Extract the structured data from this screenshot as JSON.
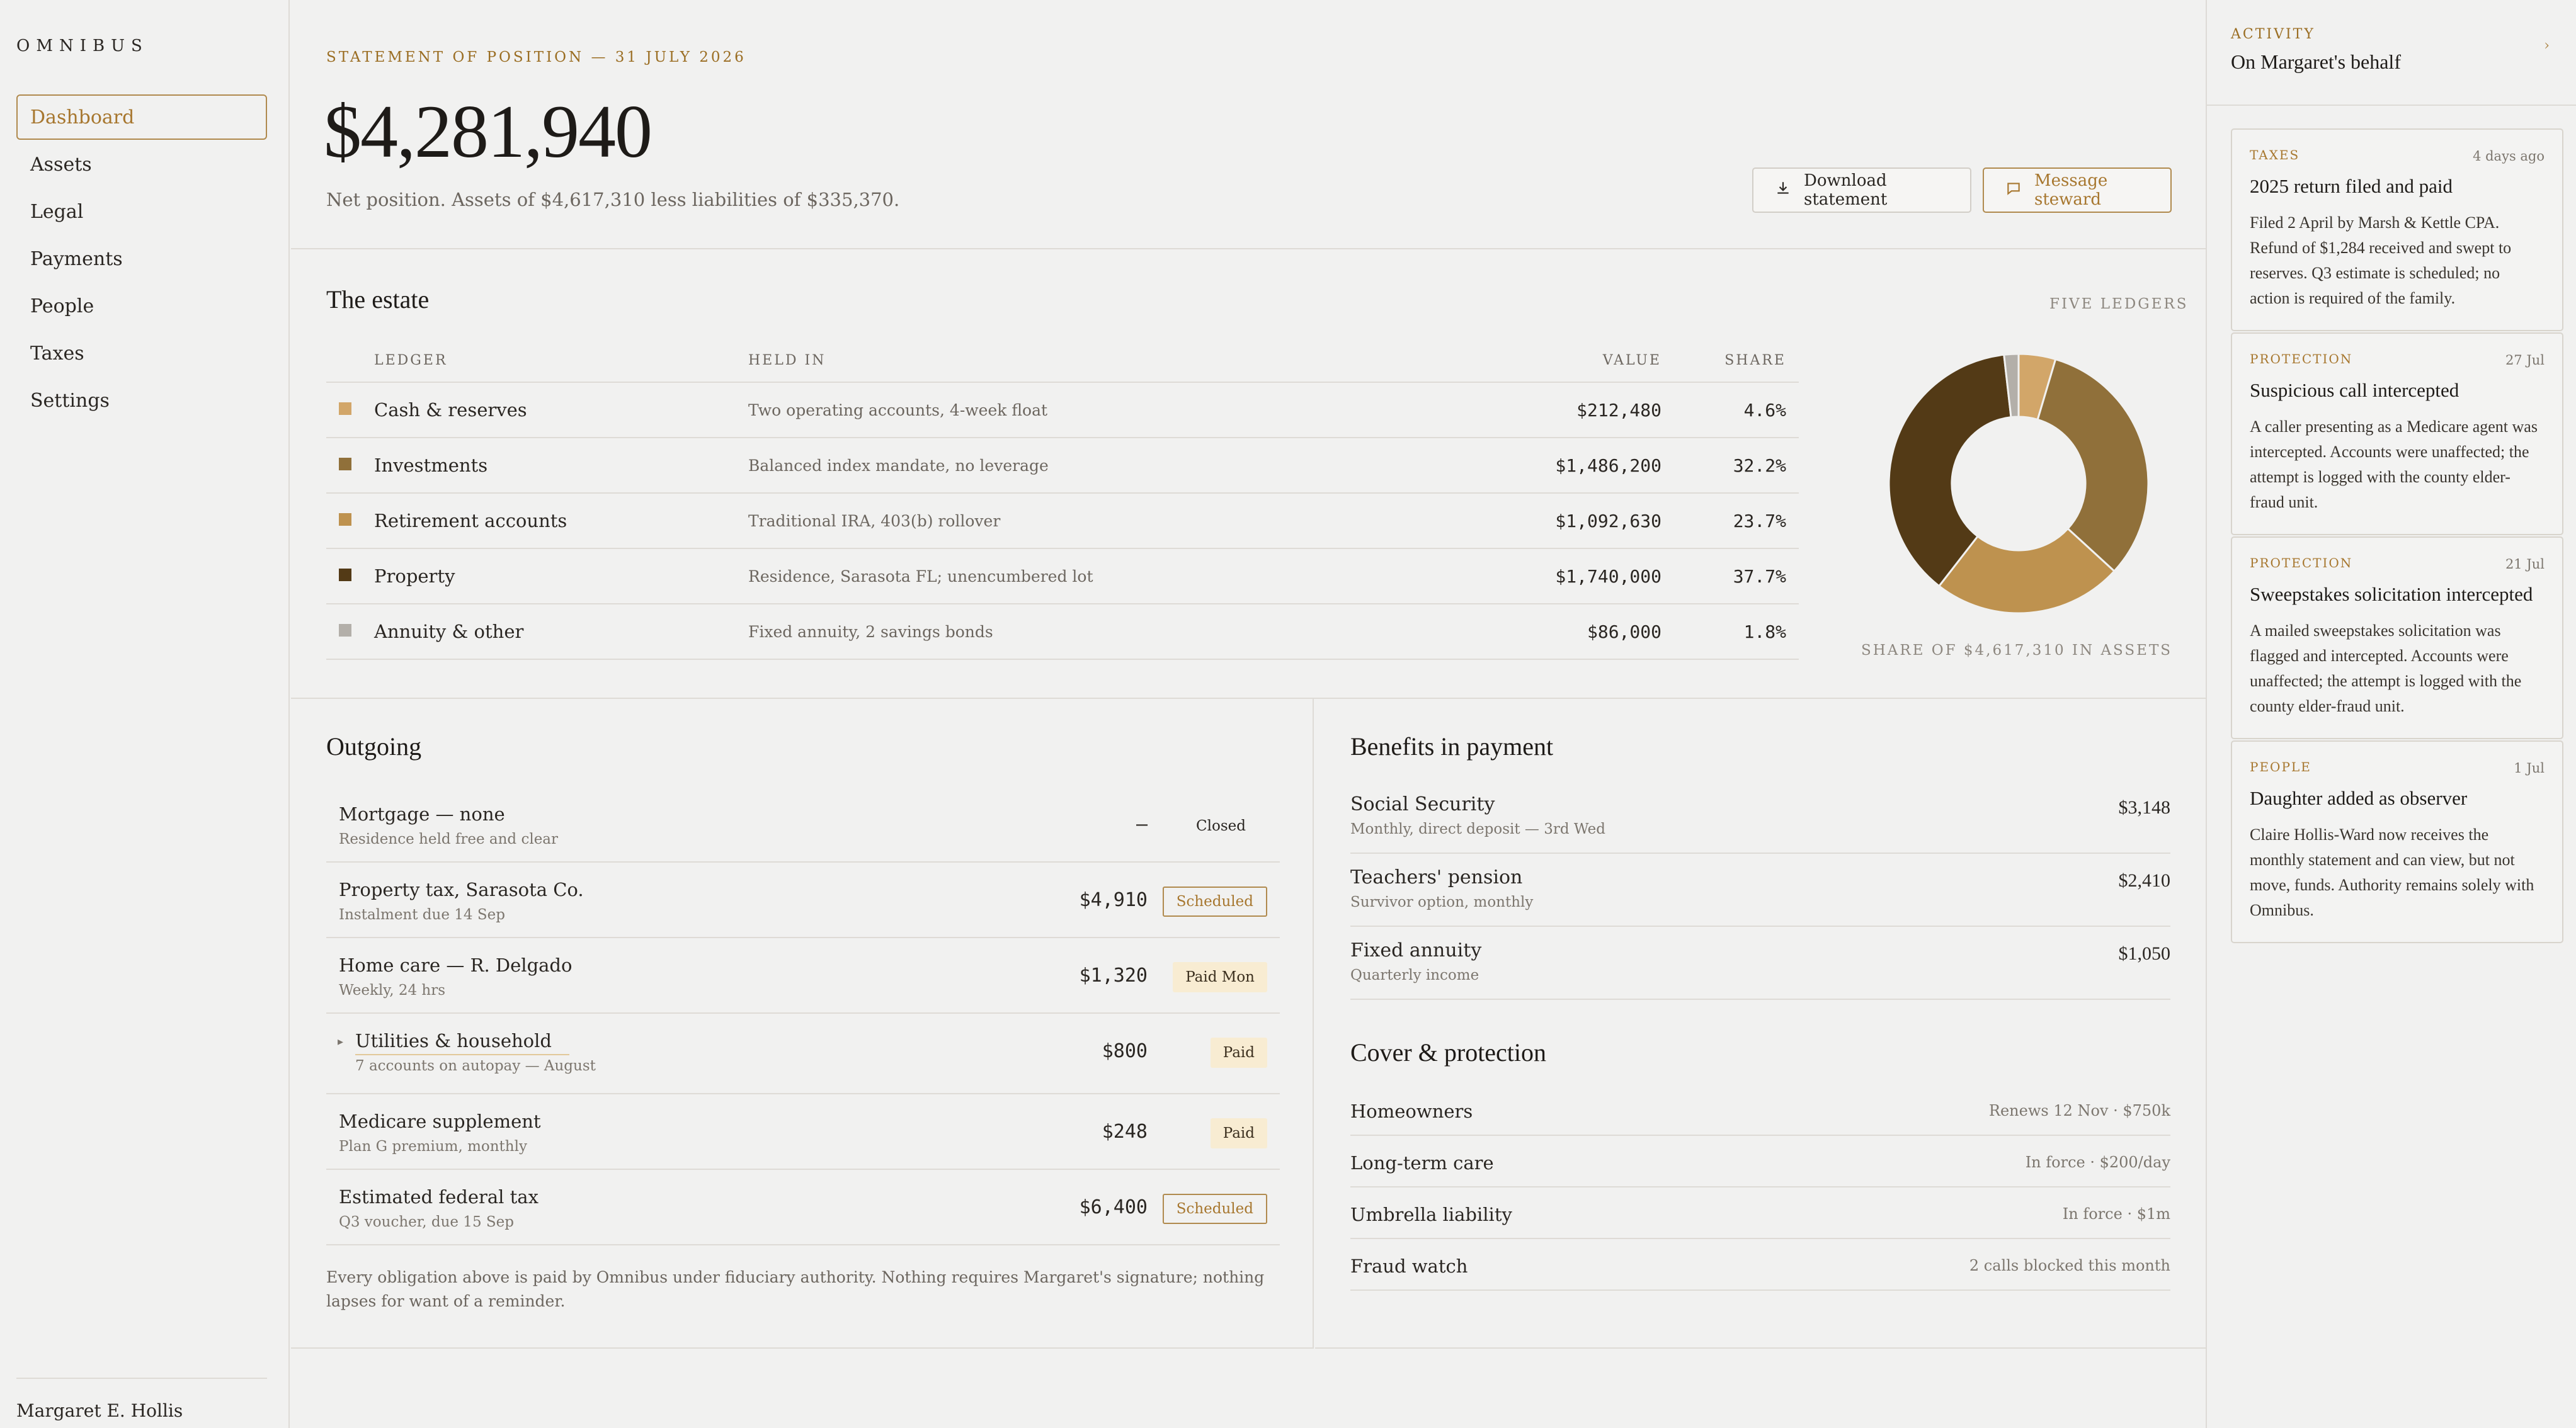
{
  "app": {
    "brand": "OMNIBUS"
  },
  "nav": {
    "items": [
      {
        "label": "Dashboard"
      },
      {
        "label": "Assets"
      },
      {
        "label": "Legal"
      },
      {
        "label": "Payments"
      },
      {
        "label": "People"
      },
      {
        "label": "Taxes"
      },
      {
        "label": "Settings"
      }
    ],
    "active": "Dashboard",
    "user": "Margaret E. Hollis"
  },
  "hero": {
    "eyebrow": "STATEMENT OF POSITION — 31 JULY 2026",
    "amount": "$4,281,940",
    "subtitle": "Net position. Assets of $4,617,310 less liabilities of $335,370.",
    "download_label": "Download statement",
    "message_label": "Message steward"
  },
  "estate": {
    "title": "The estate",
    "tag": "FIVE LEDGERS",
    "headers": {
      "ledger": "LEDGER",
      "held": "HELD IN",
      "value": "VALUE",
      "share": "SHARE"
    },
    "rows": [
      {
        "name": "Cash & reserves",
        "held": "Two operating accounts, 4-week float",
        "value": "$212,480",
        "share": "4.6%",
        "color": "#d2a669"
      },
      {
        "name": "Investments",
        "held": "Balanced index mandate, no leverage",
        "value": "$1,486,200",
        "share": "32.2%",
        "color": "#90703a"
      },
      {
        "name": "Retirement accounts",
        "held": "Traditional IRA, 403(b) rollover",
        "value": "$1,092,630",
        "share": "23.7%",
        "color": "#be924f"
      },
      {
        "name": "Property",
        "held": "Residence, Sarasota FL; unencumbered lot",
        "value": "$1,740,000",
        "share": "37.7%",
        "color": "#533a16"
      },
      {
        "name": "Annuity & other",
        "held": "Fixed annuity, 2 savings bonds",
        "value": "$86,000",
        "share": "1.8%",
        "color": "#b3afa9"
      }
    ],
    "caption": "SHARE OF $4,617,310 IN ASSETS"
  },
  "chart_data": {
    "type": "pie",
    "donut": true,
    "categories": [
      "Cash & reserves",
      "Investments",
      "Retirement accounts",
      "Property",
      "Annuity & other"
    ],
    "values": [
      4.6,
      32.2,
      23.7,
      37.7,
      1.8
    ],
    "colors": [
      "#d2a669",
      "#90703a",
      "#be924f",
      "#533a16",
      "#b3afa9"
    ],
    "title": "",
    "xlabel": "",
    "ylabel": ""
  },
  "outgoing": {
    "title": "Outgoing",
    "rows": [
      {
        "name": "Mortgage — none",
        "sub": "Residence held free and clear",
        "amount": "—",
        "badge": "Closed",
        "kind": "closed"
      },
      {
        "name": "Property tax, Sarasota Co.",
        "sub": "Instalment due 14 Sep",
        "amount": "$4,910",
        "badge": "Scheduled",
        "kind": "scheduled"
      },
      {
        "name": "Home care — R. Delgado",
        "sub": "Weekly, 24 hrs",
        "amount": "$1,320",
        "badge": "Paid Mon",
        "kind": "paid"
      },
      {
        "name": "Utilities & household",
        "sub": "7 accounts on autopay — August",
        "amount": "$800",
        "badge": "Paid",
        "kind": "paid"
      },
      {
        "name": "Medicare supplement",
        "sub": "Plan G premium, monthly",
        "amount": "$248",
        "badge": "Paid",
        "kind": "paid"
      },
      {
        "name": "Estimated federal tax",
        "sub": "Q3 voucher, due 15 Sep",
        "amount": "$6,400",
        "badge": "Scheduled",
        "kind": "scheduled"
      }
    ],
    "footnote": "Every obligation above is paid by Omnibus under fiduciary authority. Nothing requires Margaret's signature; nothing lapses for want of a reminder."
  },
  "benefits": {
    "title": "Benefits in payment",
    "rows": [
      {
        "name": "Social Security",
        "sub": "Monthly, direct deposit — 3rd Wed",
        "amount": "$3,148"
      },
      {
        "name": "Teachers' pension",
        "sub": "Survivor option, monthly",
        "amount": "$2,410"
      },
      {
        "name": "Fixed annuity",
        "sub": "Quarterly income",
        "amount": "$1,050"
      }
    ]
  },
  "cover": {
    "title": "Cover & protection",
    "rows": [
      {
        "name": "Homeowners",
        "value": "Renews 12 Nov · $750k"
      },
      {
        "name": "Long-term care",
        "value": "In force · $200/day"
      },
      {
        "name": "Umbrella liability",
        "value": "In force · $1m"
      },
      {
        "name": "Fraud watch",
        "value": "2 calls blocked this month"
      }
    ]
  },
  "activity": {
    "eyebrow": "ACTIVITY",
    "title": "On Margaret's behalf",
    "chevron": "›",
    "cards": [
      {
        "category": "TAXES",
        "date": "4 days ago",
        "title": "2025 return filed and paid",
        "body": "Filed 2 April by Marsh & Kettle CPA. Refund of $1,284 received and swept to reserves. Q3 estimate is scheduled; no action is required of the family."
      },
      {
        "category": "PROTECTION",
        "date": "27 Jul",
        "title": "Suspicious call intercepted",
        "body": "A caller presenting as a Medicare agent was intercepted. Accounts were unaffected; the attempt is logged with the county elder-fraud unit."
      },
      {
        "category": "PROTECTION",
        "date": "21 Jul",
        "title": "Sweepstakes solicitation intercepted",
        "body": "A mailed sweepstakes solicitation was flagged and intercepted. Accounts were unaffected; the attempt is logged with the county elder-fraud unit."
      },
      {
        "category": "PEOPLE",
        "date": "1 Jul",
        "title": "Daughter added as observer",
        "body": "Claire Hollis-Ward now receives the monthly statement and can view, but not move, funds. Authority remains solely with Omnibus."
      }
    ]
  }
}
